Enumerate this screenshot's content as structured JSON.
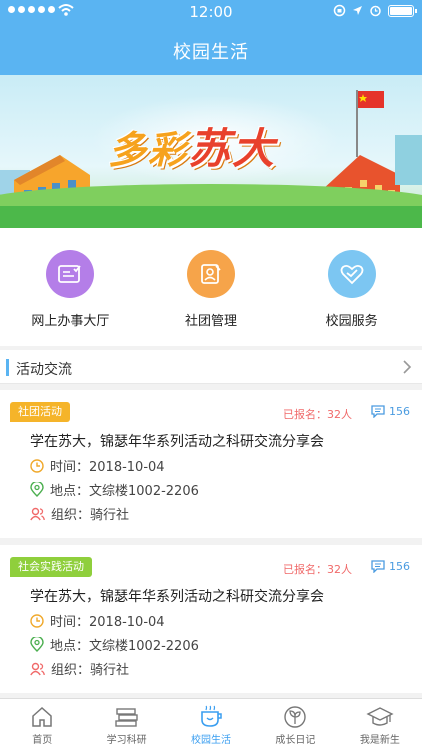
{
  "status_bar": {
    "time": "12:00"
  },
  "header": {
    "title": "校园生活"
  },
  "banner": {
    "text_prefix": "多彩",
    "text_highlight": "苏大"
  },
  "shortcuts": [
    {
      "label": "网上办事大厅",
      "icon": "form-icon",
      "color": "#b47ee8"
    },
    {
      "label": "社团管理",
      "icon": "badge-icon",
      "color": "#f6a44a"
    },
    {
      "label": "校园服务",
      "icon": "heart-shield-icon",
      "color": "#7cc6f2"
    }
  ],
  "section": {
    "title": "活动交流"
  },
  "activities": [
    {
      "tag": "社团活动",
      "tag_color": "#f5b42a",
      "enrolled": "已报名：32人",
      "comments": "156",
      "title": "学在苏大，锦瑟年华系列活动之科研交流分享会",
      "time": "时间：2018-10-04",
      "location": "地点：文综楼1002-2206",
      "organizer": "组织：骑行社"
    },
    {
      "tag": "社会实践活动",
      "tag_color": "#8fcf3c",
      "enrolled": "已报名：32人",
      "comments": "156",
      "title": "学在苏大，锦瑟年华系列活动之科研交流分享会",
      "time": "时间：2018-10-04",
      "location": "地点：文综楼1002-2206",
      "organizer": "组织：骑行社"
    }
  ],
  "tabs": [
    {
      "label": "首页",
      "icon": "home-icon",
      "active": false
    },
    {
      "label": "学习科研",
      "icon": "books-icon",
      "active": false
    },
    {
      "label": "校园生活",
      "icon": "cup-icon",
      "active": true
    },
    {
      "label": "成长日记",
      "icon": "sprout-icon",
      "active": false
    },
    {
      "label": "我是新生",
      "icon": "graduation-cap-icon",
      "active": false
    }
  ]
}
